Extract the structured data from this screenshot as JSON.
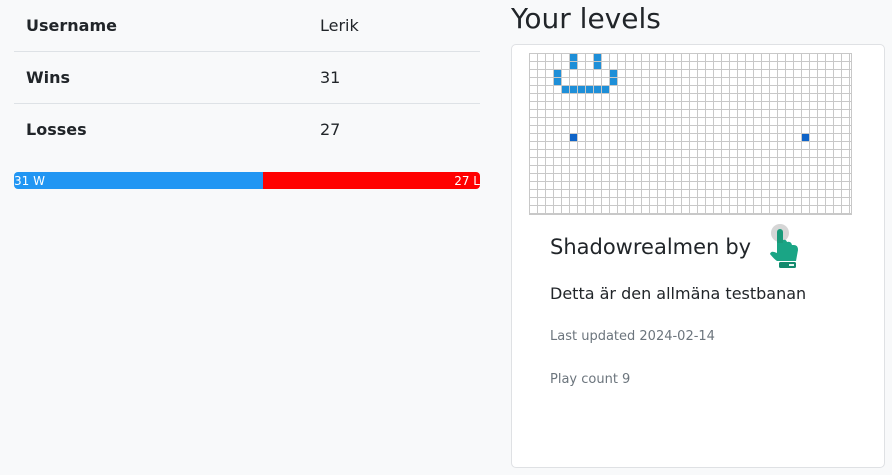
{
  "stats": {
    "rows": [
      {
        "label": "Username",
        "value": "Lerik"
      },
      {
        "label": "Wins",
        "value": "31"
      },
      {
        "label": "Losses",
        "value": "27"
      }
    ],
    "bar": {
      "wins": 31,
      "losses": 27,
      "wins_label": "31 W",
      "losses_label": "27 L",
      "wins_color": "#2196f3",
      "losses_color": "#ff0000"
    }
  },
  "levels": {
    "heading": "Your levels",
    "cards": [
      {
        "title": "Shadowrealmen",
        "author_prefix": "by",
        "author_icon": "pointing-hand-icon",
        "description": "Detta är den allmäna testbanan",
        "updated_label": "Last updated 2024-02-14",
        "play_count_label": "Play count 9",
        "preview_colors": {
          "cell": "#1e8fd8",
          "dark_cell": "#0f64c8",
          "grid": "#c8c8c8"
        }
      }
    ]
  }
}
